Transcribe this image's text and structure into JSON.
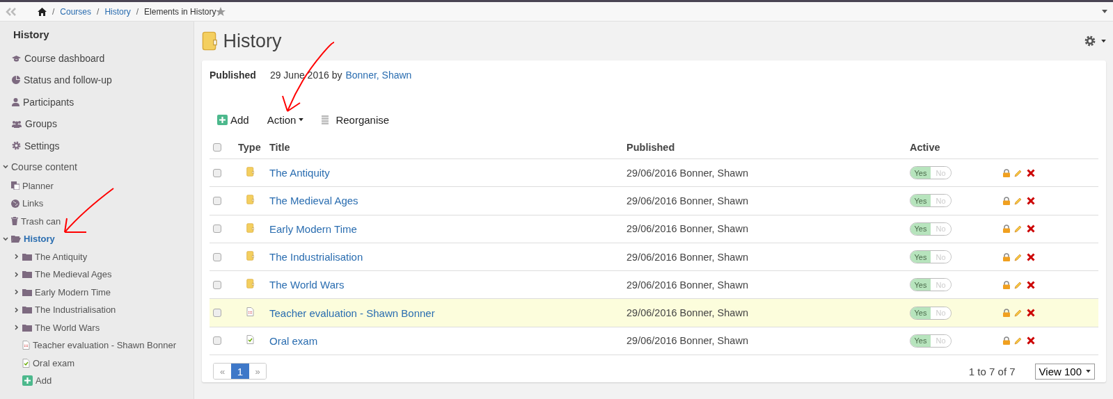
{
  "breadcrumb": {
    "items": [
      {
        "kind": "home"
      },
      {
        "kind": "link",
        "label": "Courses"
      },
      {
        "kind": "link",
        "label": "History"
      },
      {
        "kind": "current",
        "label": "Elements in History"
      }
    ],
    "separators": [
      "/",
      "/",
      "/"
    ]
  },
  "sidebar": {
    "title": "History",
    "nav": [
      {
        "kind": "dashboard",
        "label": "Course dashboard"
      },
      {
        "kind": "status",
        "label": "Status and follow-up"
      },
      {
        "kind": "participants",
        "label": "Participants"
      },
      {
        "kind": "groups",
        "label": "Groups"
      },
      {
        "kind": "settings",
        "label": "Settings"
      }
    ],
    "tree": {
      "label": "Course content",
      "expanded": true,
      "children": [
        {
          "kind": "planner",
          "label": "Planner"
        },
        {
          "kind": "links",
          "label": "Links"
        },
        {
          "kind": "trash",
          "label": "Trash can"
        },
        {
          "kind": "folder-open",
          "label": "History",
          "expanded": true,
          "selected": true,
          "children": [
            {
              "kind": "folder",
              "label": "The Antiquity",
              "expanded": false,
              "selected": false
            },
            {
              "kind": "folder",
              "label": "The Medieval Ages",
              "expanded": false,
              "selected": false
            },
            {
              "kind": "folder",
              "label": "Early Modern Time",
              "expanded": false,
              "selected": false
            },
            {
              "kind": "folder",
              "label": "The Industrialisation",
              "expanded": false,
              "selected": false
            },
            {
              "kind": "folder",
              "label": "The World Wars",
              "expanded": false,
              "selected": false
            },
            {
              "kind": "form",
              "label": "Teacher evaluation - Shawn Bonner",
              "selected": false
            },
            {
              "kind": "test",
              "label": "Oral exam",
              "selected": false
            },
            {
              "kind": "add",
              "label": "Add"
            }
          ]
        }
      ]
    }
  },
  "page": {
    "title": "History",
    "published_label": "Published",
    "published_text": "29 June 2016 by",
    "author": "Bonner, Shawn",
    "toolbar": [
      {
        "kind": "add",
        "label": "Add"
      },
      {
        "kind": "dropdown",
        "label": "Action"
      },
      {
        "kind": "reorder",
        "label": "Reorganise"
      }
    ],
    "table": {
      "select_all_checked": false,
      "columns": [
        "Type",
        "Title",
        "Published",
        "Active"
      ],
      "rows": [
        {
          "kind": "folder",
          "title": "The Antiquity",
          "published": "29/06/2016 Bonner, Shawn",
          "active": true,
          "yes": "Yes",
          "no": "No",
          "highlighted": false,
          "checked": false
        },
        {
          "kind": "folder",
          "title": "The Medieval Ages",
          "published": "29/06/2016 Bonner, Shawn",
          "active": true,
          "yes": "Yes",
          "no": "No",
          "highlighted": false,
          "checked": false
        },
        {
          "kind": "folder",
          "title": "Early Modern Time",
          "published": "29/06/2016 Bonner, Shawn",
          "active": true,
          "yes": "Yes",
          "no": "No",
          "highlighted": false,
          "checked": false
        },
        {
          "kind": "folder",
          "title": "The Industrialisation",
          "published": "29/06/2016 Bonner, Shawn",
          "active": true,
          "yes": "Yes",
          "no": "No",
          "highlighted": false,
          "checked": false
        },
        {
          "kind": "folder",
          "title": "The World Wars",
          "published": "29/06/2016 Bonner, Shawn",
          "active": true,
          "yes": "Yes",
          "no": "No",
          "highlighted": false,
          "checked": false
        },
        {
          "kind": "form",
          "title": "Teacher evaluation - Shawn Bonner",
          "published": "29/06/2016 Bonner, Shawn",
          "active": true,
          "yes": "Yes",
          "no": "No",
          "highlighted": true,
          "checked": false
        },
        {
          "kind": "test",
          "title": "Oral exam",
          "published": "29/06/2016 Bonner, Shawn",
          "active": true,
          "yes": "Yes",
          "no": "No",
          "highlighted": false,
          "checked": false
        }
      ]
    },
    "pagination": {
      "prev": "«",
      "pages": [
        {
          "label": "1",
          "selected": true
        }
      ],
      "next": "»",
      "summary": "1 to 7 of 7",
      "page_size": "View 100"
    }
  }
}
